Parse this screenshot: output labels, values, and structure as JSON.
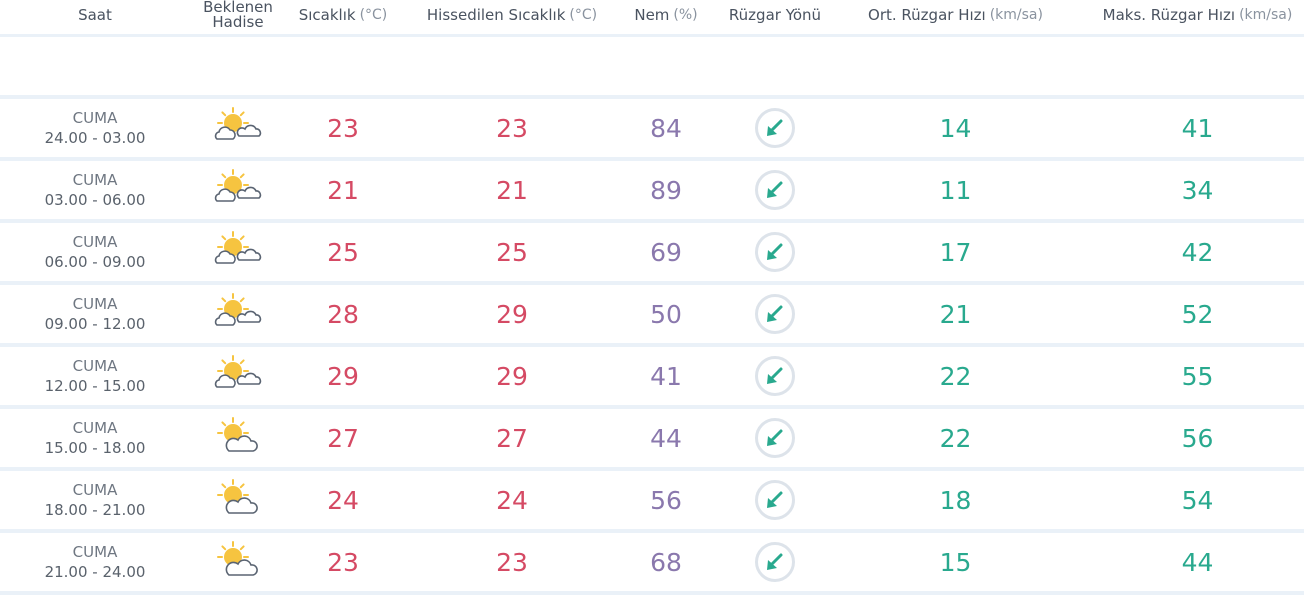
{
  "headers": {
    "saat": "Saat",
    "hadise_line1": "Beklenen",
    "hadise_line2": "Hadise",
    "sicaklik": "Sıcaklık",
    "sicaklik_unit": "(°C)",
    "hissedilen": "Hissedilen Sıcaklık",
    "hissedilen_unit": "(°C)",
    "nem": "Nem",
    "nem_unit": "(%)",
    "ruzgar_yonu": "Rüzgar Yönü",
    "ort_ruzgar": "Ort. Rüzgar Hızı",
    "ort_ruzgar_unit": "(km/sa)",
    "maks_ruzgar": "Maks. Rüzgar Hızı",
    "maks_ruzgar_unit": "(km/sa)"
  },
  "colors": {
    "temp": "#d54a64",
    "humidity": "#8a78ad",
    "wind": "#29a98e",
    "sun": "#f6c440",
    "cloud": "#5a6472"
  },
  "rows": [
    {
      "day": "CUMA",
      "time": "24.00 - 03.00",
      "icon": "sun-cloud-cloud-icon",
      "temp": "23",
      "feels": "23",
      "humidity": "84",
      "wind_dir": "arrow-down-left-icon",
      "avg_wind": "14",
      "max_wind": "41"
    },
    {
      "day": "CUMA",
      "time": "03.00 - 06.00",
      "icon": "sun-cloud-cloud-icon",
      "temp": "21",
      "feels": "21",
      "humidity": "89",
      "wind_dir": "arrow-down-left-icon",
      "avg_wind": "11",
      "max_wind": "34"
    },
    {
      "day": "CUMA",
      "time": "06.00 - 09.00",
      "icon": "sun-cloud-cloud-icon",
      "temp": "25",
      "feels": "25",
      "humidity": "69",
      "wind_dir": "arrow-down-left-icon",
      "avg_wind": "17",
      "max_wind": "42"
    },
    {
      "day": "CUMA",
      "time": "09.00 - 12.00",
      "icon": "sun-cloud-cloud-icon",
      "temp": "28",
      "feels": "29",
      "humidity": "50",
      "wind_dir": "arrow-down-left-icon",
      "avg_wind": "21",
      "max_wind": "52"
    },
    {
      "day": "CUMA",
      "time": "12.00 - 15.00",
      "icon": "sun-cloud-cloud-icon",
      "temp": "29",
      "feels": "29",
      "humidity": "41",
      "wind_dir": "arrow-down-left-icon",
      "avg_wind": "22",
      "max_wind": "55"
    },
    {
      "day": "CUMA",
      "time": "15.00 - 18.00",
      "icon": "sun-cloud-icon",
      "temp": "27",
      "feels": "27",
      "humidity": "44",
      "wind_dir": "arrow-down-left-icon",
      "avg_wind": "22",
      "max_wind": "56"
    },
    {
      "day": "CUMA",
      "time": "18.00 - 21.00",
      "icon": "sun-cloud-icon",
      "temp": "24",
      "feels": "24",
      "humidity": "56",
      "wind_dir": "arrow-down-left-icon",
      "avg_wind": "18",
      "max_wind": "54"
    },
    {
      "day": "CUMA",
      "time": "21.00 - 24.00",
      "icon": "sun-cloud-icon",
      "temp": "23",
      "feels": "23",
      "humidity": "68",
      "wind_dir": "arrow-down-left-icon",
      "avg_wind": "15",
      "max_wind": "44"
    }
  ]
}
